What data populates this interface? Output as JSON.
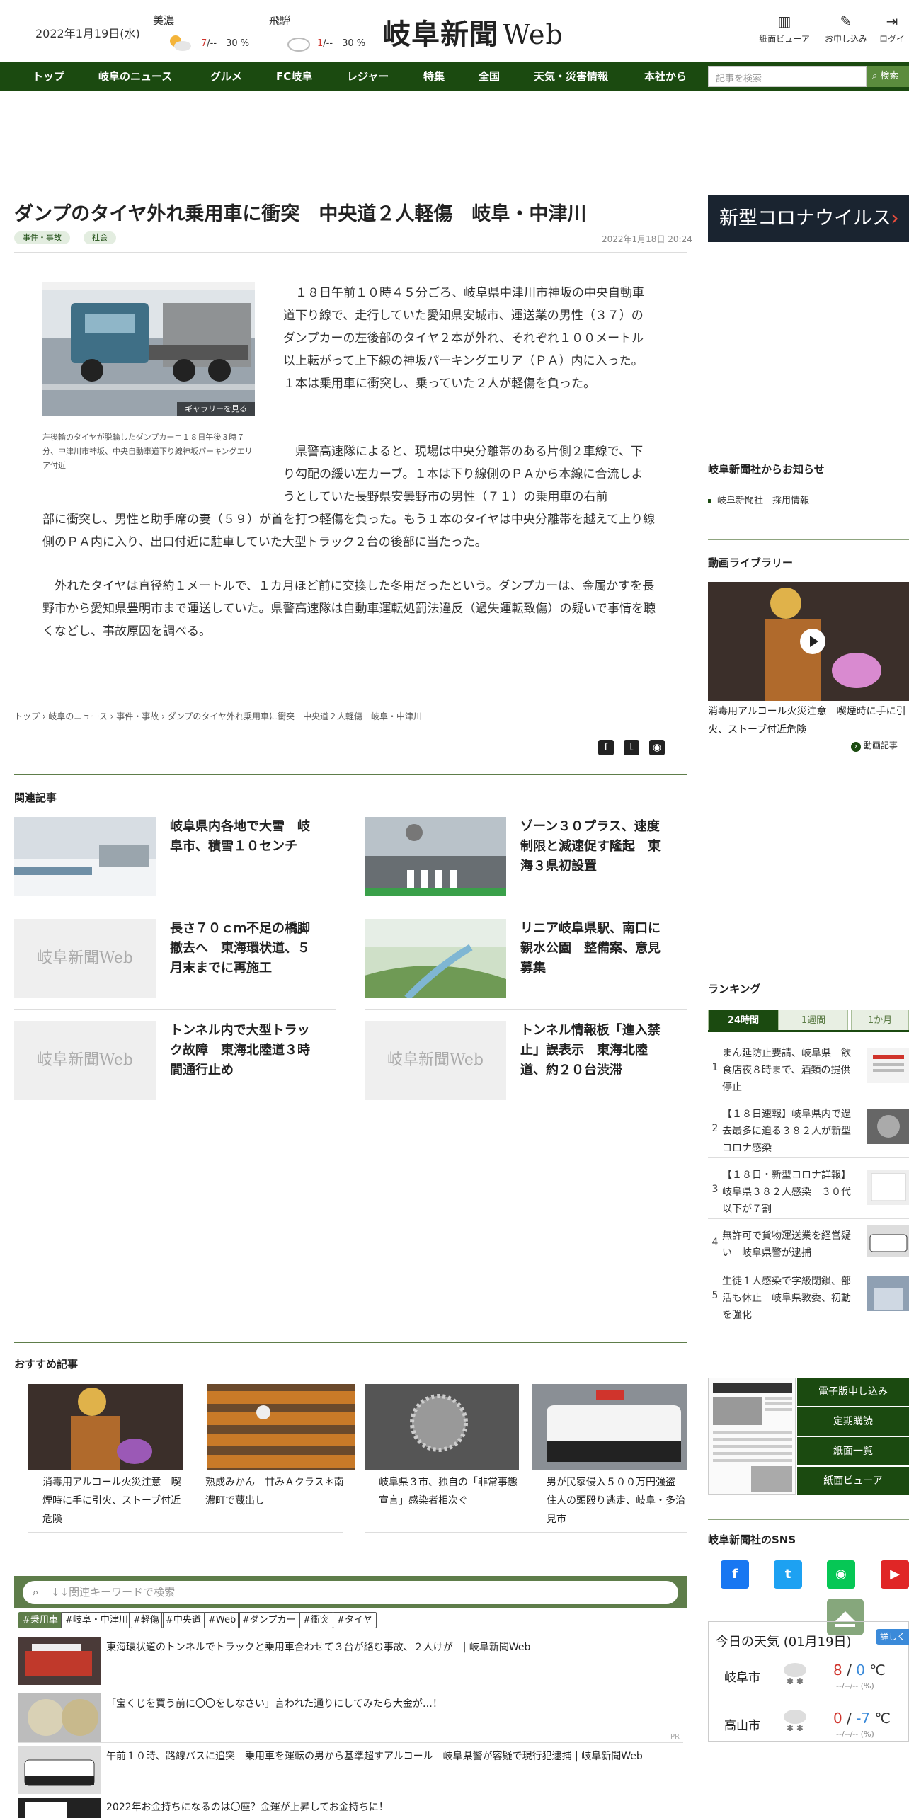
{
  "header": {
    "date": "2022年1月19日(水)",
    "weather": [
      {
        "city": "美濃",
        "hi": "7",
        "lo": "--",
        "pct": "30 %"
      },
      {
        "city": "飛騨",
        "hi": "1",
        "lo": "--",
        "pct": "30 %"
      }
    ],
    "logo_main": "岐阜新聞",
    "logo_web": "Web",
    "links": [
      {
        "label": "紙面ビューア",
        "icon": "book-icon"
      },
      {
        "label": "お申し込み",
        "icon": "pen-icon"
      },
      {
        "label": "ログイ",
        "icon": "login-icon"
      }
    ]
  },
  "nav": {
    "items": [
      "トップ",
      "岐阜のニュース",
      "グルメ",
      "FC岐阜",
      "レジャー",
      "特集",
      "全国",
      "天気・災害情報",
      "本社から"
    ],
    "search_placeholder": "記事を検索",
    "search_button": "検索"
  },
  "article": {
    "title": "ダンプのタイヤ外れ乗用車に衝突　中央道２人軽傷　岐阜・中津川",
    "tags": [
      "事件・事故",
      "社会"
    ],
    "date": "2022年1月18日 20:24",
    "gallery_label": "ギャラリーを見る",
    "caption": "左後輪のタイヤが脱輪したダンプカー＝１８日午後３時７分、中津川市神坂、中央自動車道下り線神坂パーキングエリア付近",
    "paragraphs": [
      "１８日午前１０時４５分ごろ、岐阜県中津川市神坂の中央自動車道下り線で、走行していた愛知県安城市、運送業の男性（３７）のダンプカーの左後部のタイヤ２本が外れ、それぞれ１００メートル以上転がって上下線の神坂パーキングエリア（ＰＡ）内に入った。１本は乗用車に衝突し、乗っていた２人が軽傷を負った。",
      "県警高速隊によると、現場は中央分離帯のある片側２車線で、下り勾配の緩い左カーブ。１本は下り線側のＰＡから本線に合流しようとしていた長野県安曇野市の男性（７１）の乗用車の右前部に衝突し、男性と助手席の妻（５９）が首を打つ軽傷を負った。もう１本のタイヤは中央分離帯を越えて上り線側のＰＡ内に入り、出口付近に駐車していた大型トラック２台の後部に当たった。",
      "外れたタイヤは直径約１メートルで、１カ月ほど前に交換した冬用だったという。ダンプカーは、金属かすを長野市から愛知県豊明市まで運送していた。県警高速隊は自動車運転処罰法違反（過失運転致傷）の疑いで事情を聴くなどし、事故原因を調べる。"
    ],
    "breadcrumb": "トップ › 岐阜のニュース › 事件・事故 › ダンプのタイヤ外れ乗用車に衝突　中央道２人軽傷　岐阜・中津川"
  },
  "related": {
    "heading": "関連記事",
    "items": [
      {
        "title": "岐阜県内各地で大雪　岐阜市、積雪１０センチ"
      },
      {
        "title": "ゾーン３０プラス、速度制限と減速促す隆起　東海３県初設置"
      },
      {
        "title": "長さ７０ｃｍ不足の橋脚撤去へ　東海環状道、５月末までに再施工"
      },
      {
        "title": "リニア岐阜県駅、南口に親水公園　整備案、意見募集"
      },
      {
        "title": "トンネル内で大型トラック故障　東海北陸道３時間通行止め"
      },
      {
        "title": "トンネル情報板「進入禁止」誤表示　東海北陸道、約２０台渋滞"
      }
    ],
    "placeholder_logo": "岐阜新聞Web"
  },
  "recommended": {
    "heading": "おすすめ記事",
    "items": [
      {
        "title": "消毒用アルコール火災注意　喫煙時に手に引火、ストーブ付近危険"
      },
      {
        "title": "熟成みかん　甘みＡクラス＊南濃町で蔵出し"
      },
      {
        "title": "岐阜県３市、独自の「非常事態宣言」感染者相次ぐ"
      },
      {
        "title": "男が民家侵入５００万円強盗　住人の頭殴り逃走、岐阜・多治見市"
      }
    ]
  },
  "keywords": {
    "search_placeholder": "↓↓関連キーワードで検索",
    "tags": [
      "#乗用車",
      "#岐阜・中津川",
      "#軽傷",
      "#中央道",
      "#Web",
      "#ダンプカー",
      "#衝突",
      "#タイヤ"
    ],
    "ads": [
      "東海環状道のトンネルでトラックと乗用車合わせて３台が絡む事故、２人けが　| 岐阜新聞Web",
      "「宝くじを買う前に〇〇をしなさい」言われた通りにしてみたら大金が…！",
      "午前１０時、路線バスに追突　乗用車を運転の男から基準超すアルコール　岐阜県警が容疑で現行犯逮捕 | 岐阜新聞Web",
      "2022年お金持ちになるのは〇座？金運が上昇してお金持ちに！"
    ],
    "pr": "PR"
  },
  "sidebar": {
    "banner": "新型コロナウイルス",
    "notice_heading": "岐阜新聞社からお知らせ",
    "notice_items": [
      "岐阜新聞社　採用情報"
    ],
    "video_heading": "動画ライブラリー",
    "video_title": "消毒用アルコール火災注意　喫煙時に手に引火、ストーブ付近危険",
    "video_more": "動画記事一",
    "ranking_heading": "ランキング",
    "ranking_tabs": [
      "24時間",
      "1週間",
      "1か月"
    ],
    "ranking": [
      {
        "num": "1",
        "text": "まん延防止要請、岐阜県　飲食店夜８時まで、酒類の提供停止"
      },
      {
        "num": "2",
        "text": "【１８日速報】岐阜県内で過去最多に迫る３８２人が新型コロナ感染"
      },
      {
        "num": "3",
        "text": "【１８日・新型コロナ詳報】岐阜県３８２人感染　３０代以下が７割"
      },
      {
        "num": "4",
        "text": "無許可で貨物運送業を経営疑い　岐阜県警が逮捕"
      },
      {
        "num": "5",
        "text": "生徒１人感染で学級閉鎖、部活も休止　岐阜県教委、初動を強化"
      }
    ],
    "paper_buttons": [
      "電子版申し込み",
      "定期購読",
      "紙面一覧",
      "紙面ビューア"
    ],
    "sns_heading": "岐阜新聞社のSNS",
    "weather_heading": "今日の天気 (01月19日)",
    "weather_button": "詳しく",
    "weather": [
      {
        "city": "岐阜市",
        "hi": "8",
        "lo": "0",
        "sub": "--/--/-- (%)"
      },
      {
        "city": "高山市",
        "hi": "0",
        "lo": "-7",
        "sub": "--/--/-- (%)"
      }
    ]
  }
}
